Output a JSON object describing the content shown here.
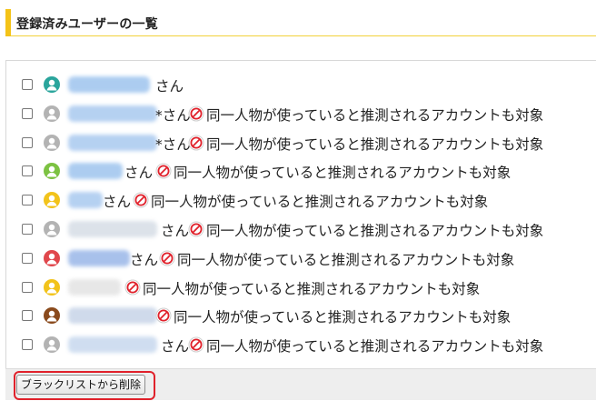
{
  "header": {
    "title": "登録済みユーザーの一覧"
  },
  "rows": [
    {
      "avatar_color": "#2aa59c",
      "name_color": "#9ec4ee",
      "suffix": "さん",
      "note": ""
    },
    {
      "avatar_color": "#b3b3b3",
      "name_color": "#a9c9ef",
      "suffix": "*さん",
      "note": "同一人物が使っていると推測されるアカウントも対象"
    },
    {
      "avatar_color": "#b3b3b3",
      "name_color": "#a9c9ef",
      "suffix": "*さん",
      "note": "同一人物が使っていると推測されるアカウントも対象"
    },
    {
      "avatar_color": "#7cc242",
      "name_color": "#9ec4ee",
      "suffix": "さん",
      "note": "同一人物が使っていると推測されるアカウントも対象"
    },
    {
      "avatar_color": "#f2c31b",
      "name_color": "#a9c9ef",
      "suffix": "さん",
      "note": "同一人物が使っていると推測されるアカウントも対象"
    },
    {
      "avatar_color": "#b3b3b3",
      "name_color": "#d6dde6",
      "suffix": "さん",
      "note": "同一人物が使っていると推測されるアカウントも対象"
    },
    {
      "avatar_color": "#e0474c",
      "name_color": "#9ab7e8",
      "suffix": "さん",
      "note": "同一人物が使っていると推測されるアカウントも対象"
    },
    {
      "avatar_color": "#f2c31b",
      "name_color": "#e3e3e3",
      "suffix": "",
      "note": "同一人物が使っていると推測されるアカウントも対象"
    },
    {
      "avatar_color": "#8a4a1c",
      "name_color": "#c7d4e8",
      "suffix": "",
      "note": "同一人物が使っていると推測されるアカウントも対象"
    },
    {
      "avatar_color": "#b3b3b3",
      "name_color": "#c7d8ee",
      "suffix": "さん",
      "note": "同一人物が使っていると推測されるアカウントも対象"
    }
  ],
  "footer": {
    "remove_button_label": "ブラックリストから削除"
  },
  "colors": {
    "accent": "#f4c318",
    "ban": "#e0212b",
    "highlight": "#e0212b"
  }
}
